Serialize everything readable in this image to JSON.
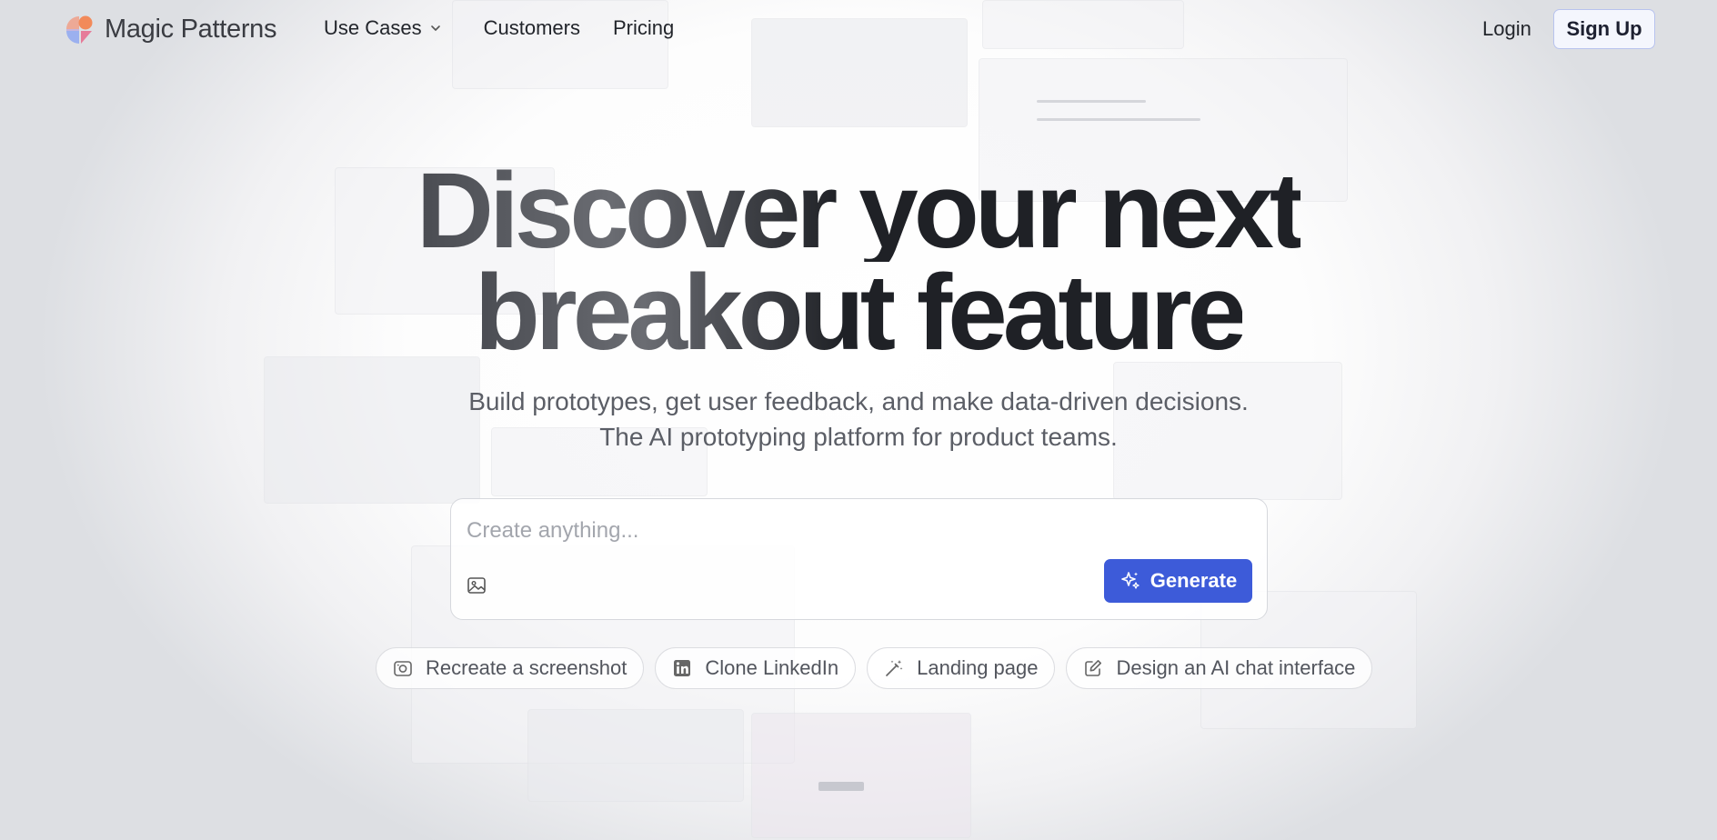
{
  "brand": {
    "name": "Magic Patterns",
    "accent": "#3d5bd9"
  },
  "nav": {
    "items": [
      {
        "label": "Use Cases",
        "icon": "chevron-down-icon"
      },
      {
        "label": "Customers"
      },
      {
        "label": "Pricing"
      }
    ],
    "login_label": "Login",
    "signup_label": "Sign Up"
  },
  "hero": {
    "title_line1": "Discover your next",
    "title_line2": "breakout feature",
    "subtitle_line1": "Build prototypes, get user feedback, and make data-driven decisions.",
    "subtitle_line2": "The AI prototyping platform for product teams."
  },
  "prompt": {
    "placeholder": "Create anything...",
    "value": "",
    "image_icon": "image-upload-icon",
    "generate_label": "Generate",
    "generate_icon": "sparkles-icon"
  },
  "suggestions": [
    {
      "label": "Recreate a screenshot",
      "icon": "camera-icon"
    },
    {
      "label": "Clone LinkedIn",
      "icon": "linkedin-icon"
    },
    {
      "label": "Landing page",
      "icon": "magic-wand-icon"
    },
    {
      "label": "Design an AI chat interface",
      "icon": "edit-icon"
    }
  ]
}
